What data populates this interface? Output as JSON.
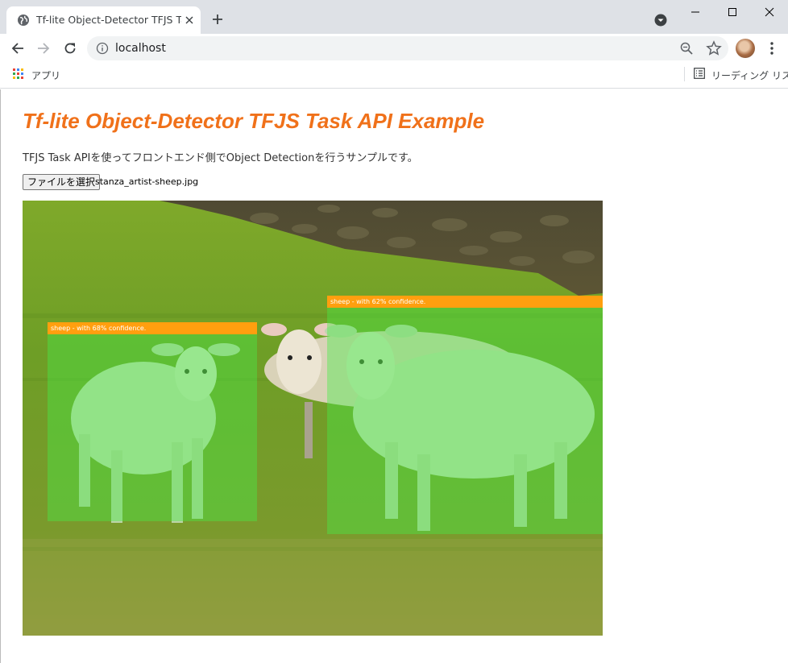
{
  "browser": {
    "tab_title": "Tf-lite Object-Detector TFJS Task API Example",
    "url": "localhost",
    "bookmarks": {
      "apps_label": "アプリ",
      "reading_list_label": "リーディング リスト"
    }
  },
  "page": {
    "title": "Tf-lite Object-Detector TFJS Task API Example",
    "description": "TFJS Task APIを使ってフロントエンド側でObject Detectionを行うサンプルです。",
    "file_button_label": "ファイルを選択",
    "file_name": "stanza_artist-sheep.jpg"
  },
  "detections": [
    {
      "label": "sheep - with 68% confidence."
    },
    {
      "label": "sheep - with 62% confidence."
    }
  ],
  "colors": {
    "title": "#f0711a",
    "label_bg": "#ff9f0f",
    "box_fill": "rgba(72,235,72,0.42)"
  }
}
